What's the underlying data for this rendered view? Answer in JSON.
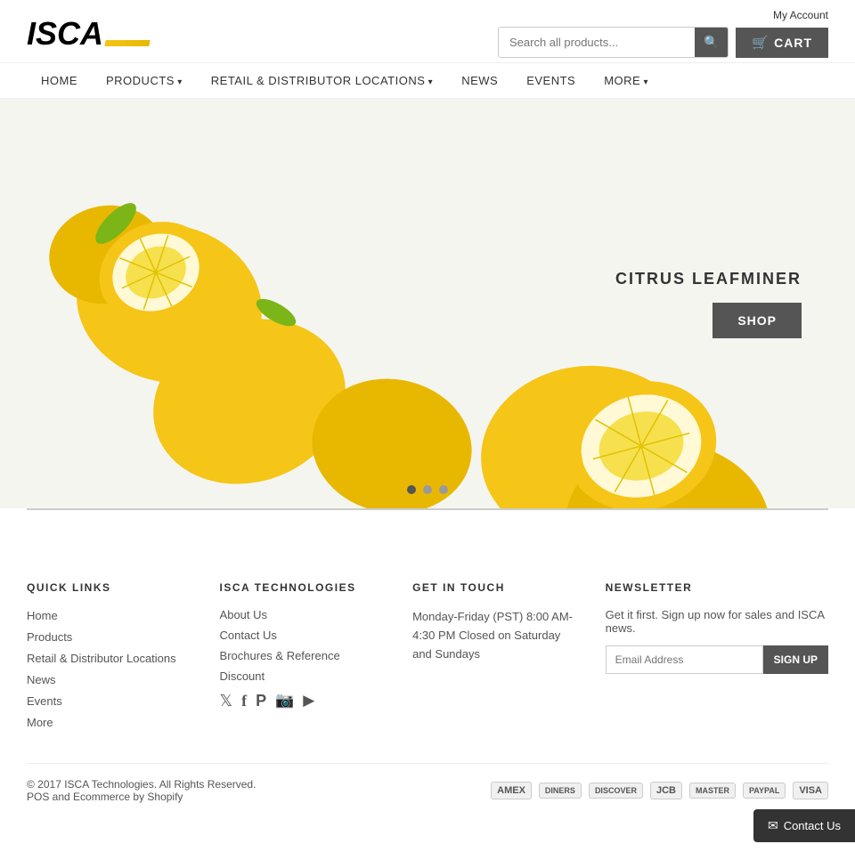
{
  "header": {
    "logo_text": "ISCA",
    "my_account_label": "My Account",
    "search_placeholder": "Search all products...",
    "search_button_label": "🔍",
    "cart_label": "CART",
    "cart_icon": "🛒"
  },
  "nav": {
    "items": [
      {
        "label": "HOME",
        "href": "#",
        "has_arrow": false
      },
      {
        "label": "PRODUCTS",
        "href": "#",
        "has_arrow": true
      },
      {
        "label": "RETAIL & DISTRIBUTOR LOCATIONS",
        "href": "#",
        "has_arrow": true
      },
      {
        "label": "NEWS",
        "href": "#",
        "has_arrow": false
      },
      {
        "label": "EVENTS",
        "href": "#",
        "has_arrow": false
      },
      {
        "label": "MORE",
        "href": "#",
        "has_arrow": true
      }
    ]
  },
  "hero": {
    "title": "CITRUS LEAFMINER",
    "shop_button": "SHOP",
    "dots": [
      {
        "active": true
      },
      {
        "active": false
      },
      {
        "active": false
      }
    ]
  },
  "footer": {
    "quick_links": {
      "heading": "QUICK LINKS",
      "items": [
        {
          "label": "Home",
          "href": "#"
        },
        {
          "label": "Products",
          "href": "#"
        },
        {
          "label": "Retail & Distributor Locations",
          "href": "#"
        },
        {
          "label": "News",
          "href": "#"
        },
        {
          "label": "Events",
          "href": "#"
        },
        {
          "label": "More",
          "href": "#"
        }
      ]
    },
    "isca_tech": {
      "heading": "ISCA TECHNOLOGIES",
      "links": [
        {
          "label": "About Us",
          "href": "#"
        },
        {
          "label": "Contact Us",
          "href": "#"
        },
        {
          "label": "Brochures & Reference",
          "href": "#"
        },
        {
          "label": "Discount",
          "href": "#"
        }
      ],
      "social": [
        {
          "label": "Twitter",
          "icon": "𝕏",
          "href": "#"
        },
        {
          "label": "Facebook",
          "icon": "f",
          "href": "#"
        },
        {
          "label": "Pinterest",
          "icon": "P",
          "href": "#"
        },
        {
          "label": "Instagram",
          "icon": "📷",
          "href": "#"
        },
        {
          "label": "YouTube",
          "icon": "▶",
          "href": "#"
        }
      ]
    },
    "get_in_touch": {
      "heading": "GET IN TOUCH",
      "hours": "Monday-Friday (PST) 8:00 AM- 4:30 PM Closed on Saturday and Sundays"
    },
    "newsletter": {
      "heading": "NEWSLETTER",
      "description": "Get it first. Sign up now for sales and ISCA news.",
      "email_placeholder": "Email Address",
      "signup_button": "SIGN UP"
    },
    "bottom": {
      "copyright": "© 2017 ISCA Technologies. All Rights Reserved.",
      "pos_text": "POS and",
      "ecommerce_text": "Ecommerce by Shopify",
      "payment_icons": [
        "American Express",
        "Diners Club",
        "Discover",
        "JCB",
        "Master",
        "PayPal",
        "Visa"
      ]
    }
  },
  "contact_float": {
    "label": "Contact Us",
    "icon": "✉"
  }
}
